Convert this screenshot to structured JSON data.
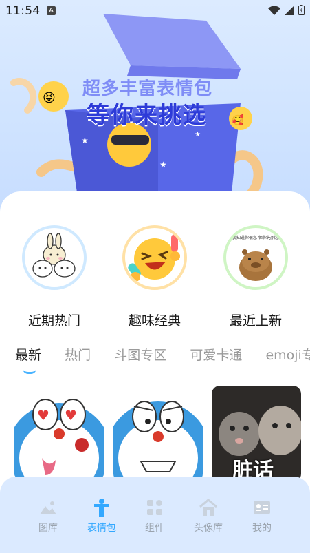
{
  "status_bar": {
    "time": "11:54",
    "a_badge": "A"
  },
  "banner": {
    "title_line1": "超多丰富表情包",
    "title_line2": "等你来挑选"
  },
  "categories": [
    {
      "label": "近期热门"
    },
    {
      "label": "趣味经典"
    },
    {
      "label": "最近上新",
      "sticker_text": "我知道你很急 但你先别急"
    }
  ],
  "tabs": [
    {
      "label": "最新",
      "active": true
    },
    {
      "label": "热门"
    },
    {
      "label": "斗图专区"
    },
    {
      "label": "可爱卡通"
    },
    {
      "label": "emoji专区"
    }
  ],
  "thumbnails": [
    {
      "caption": ""
    },
    {
      "caption": ""
    },
    {
      "caption": "脏话"
    }
  ],
  "nav": [
    {
      "label": "图库",
      "icon": "gallery-icon"
    },
    {
      "label": "表情包",
      "icon": "sticker-icon",
      "active": true
    },
    {
      "label": "组件",
      "icon": "widgets-icon"
    },
    {
      "label": "头像库",
      "icon": "home-icon"
    },
    {
      "label": "我的",
      "icon": "profile-card-icon"
    }
  ],
  "colors": {
    "accent": "#33a8ff",
    "nav_bg": "#dbeaff",
    "banner_bg": "#d3e6ff"
  }
}
